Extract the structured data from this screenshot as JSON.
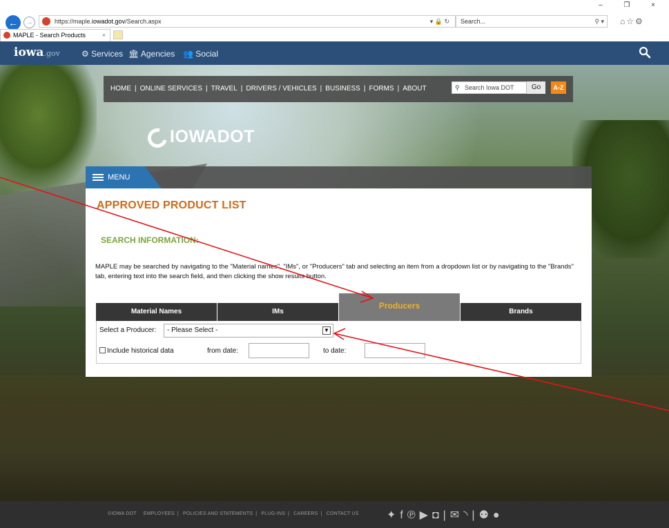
{
  "browser": {
    "url_prefix": "https://maple.",
    "url_domain": "iowadot.gov",
    "url_path": "/Search.aspx",
    "search_placeholder": "Search...",
    "tab_title": "MAPLE - Search Products",
    "tab_close": "×",
    "window_controls": "– ❐ ×"
  },
  "gov_bar": {
    "logo_text": "iowa",
    "logo_suffix": ".gov",
    "services": "Services",
    "agencies": "Agencies",
    "social": "Social"
  },
  "site_nav": {
    "links": [
      "HOME",
      "ONLINE SERVICES",
      "TRAVEL",
      "DRIVERS / VEHICLES",
      "BUSINESS",
      "FORMS",
      "ABOUT"
    ],
    "search_placeholder": "Search Iowa DOT",
    "go_label": "Go",
    "az_label": "A-Z"
  },
  "logo": {
    "text": "IOWADOT"
  },
  "menu": {
    "label": "MENU"
  },
  "content": {
    "page_title": "APPROVED PRODUCT LIST",
    "section_title": "SEARCH INFORMATION:",
    "description": "MAPLE may be searched by navigating to the \"Material names\", \"IMs\", or \"Producers\" tab and selecting an item from a dropdown list or by navigating to the \"Brands\" tab, entering text into the search field, and then clicking the show results button.",
    "tabs": [
      {
        "label": "Material Names",
        "active": false
      },
      {
        "label": "IMs",
        "active": false
      },
      {
        "label": "Producers",
        "active": true
      },
      {
        "label": "Brands",
        "active": false
      }
    ],
    "producer_label": "Select a Producer:",
    "producer_selected": "- Please Select -",
    "historical_label": "Include historical data",
    "from_date_label": "from date:",
    "to_date_label": "to date:",
    "from_date_value": "",
    "to_date_value": ""
  },
  "footer": {
    "links": [
      "©IOWA DOT",
      "EMPLOYEES",
      "POLICIES AND STATEMENTS",
      "PLUG-INS",
      "CAREERS",
      "CONTACT US"
    ]
  },
  "colors": {
    "gov_bar": "#2b4f78",
    "title_orange": "#d06a16",
    "section_green": "#7aa43a",
    "active_tab_text": "#f1b21e",
    "annotation_red": "#e0141a"
  }
}
